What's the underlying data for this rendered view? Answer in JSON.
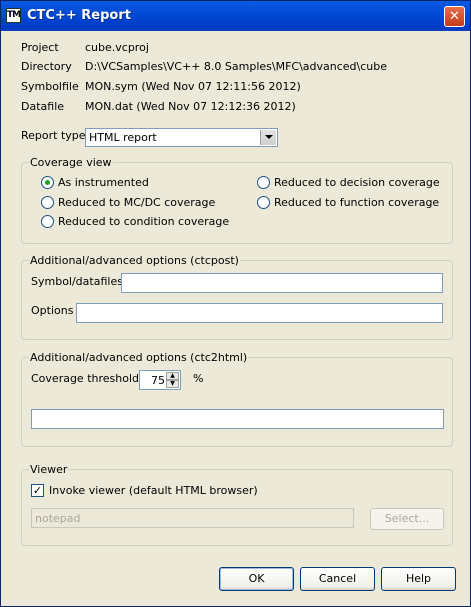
{
  "window": {
    "title": "CTC++ Report",
    "icon_text": "TM"
  },
  "info": [
    {
      "label": "Project",
      "value": "cube.vcproj"
    },
    {
      "label": "Directory",
      "value": "D:\\VCSamples\\VC++ 8.0 Samples\\MFC\\advanced\\cube"
    },
    {
      "label": "Symbolfile",
      "value": "MON.sym (Wed Nov 07 12:11:56 2012)"
    },
    {
      "label": "Datafile",
      "value": "MON.dat (Wed Nov 07 12:12:36 2012)"
    }
  ],
  "report_type": {
    "label": "Report type",
    "selected": "HTML report"
  },
  "coverage_view": {
    "title": "Coverage view",
    "options": [
      {
        "label": "As instrumented",
        "selected": true
      },
      {
        "label": "Reduced to MC/DC coverage",
        "selected": false
      },
      {
        "label": "Reduced to condition coverage",
        "selected": false
      },
      {
        "label": "Reduced to decision coverage",
        "selected": false
      },
      {
        "label": "Reduced to function coverage",
        "selected": false
      }
    ]
  },
  "ctcpost": {
    "title": "Additional/advanced options (ctcpost)",
    "symbol_label": "Symbol/datafiles",
    "symbol_value": "",
    "options_label": "Options",
    "options_value": ""
  },
  "ctc2html": {
    "title": "Additional/advanced options (ctc2html)",
    "threshold_label": "Coverage threshold",
    "threshold_value": "75",
    "percent": "%",
    "options_value": ""
  },
  "viewer": {
    "title": "Viewer",
    "invoke_label": "Invoke viewer (default HTML browser)",
    "invoke_checked": true,
    "viewer_value": "notepad",
    "select_label": "Select..."
  },
  "buttons": {
    "ok": "OK",
    "cancel": "Cancel",
    "help": "Help"
  }
}
